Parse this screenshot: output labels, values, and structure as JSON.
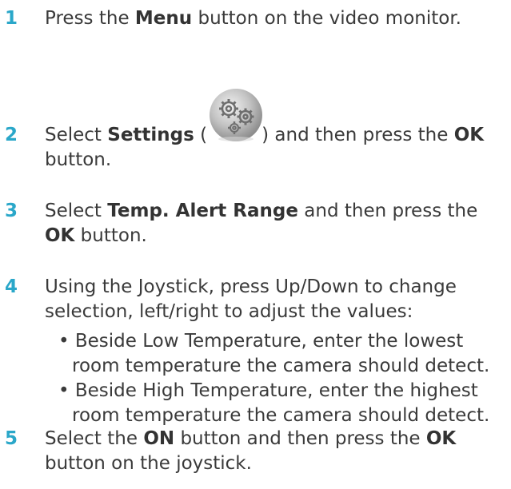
{
  "steps": [
    {
      "number": "1",
      "parts": [
        "Press the ",
        "Menu",
        " button on the video monitor."
      ]
    },
    {
      "number": "2",
      "parts": [
        "Select ",
        "Settings",
        " (",
        ") and then press the ",
        "OK",
        " button."
      ],
      "icon": "settings-gear-icon"
    },
    {
      "number": "3",
      "parts": [
        "Select ",
        "Temp. Alert Range",
        " and then press the ",
        "OK",
        " button."
      ]
    },
    {
      "number": "4",
      "text_line1": "Using the Joystick, press Up/Down to change",
      "text_line2": "selection, left/right to adjust the values:",
      "bullets": [
        "• Beside Low Temperature, enter the lowest room temperature the camera should detect.",
        "• Beside High Temperature, enter the highest room temperature the camera should detect."
      ]
    },
    {
      "number": "5",
      "parts": [
        "Select the ",
        "ON",
        " button and then press the ",
        "OK",
        " button on the joystick."
      ]
    }
  ],
  "colors": {
    "step_number": "#2aa7c9",
    "text": "#3a3a3a",
    "icon_gray": "#9a9a9a"
  }
}
